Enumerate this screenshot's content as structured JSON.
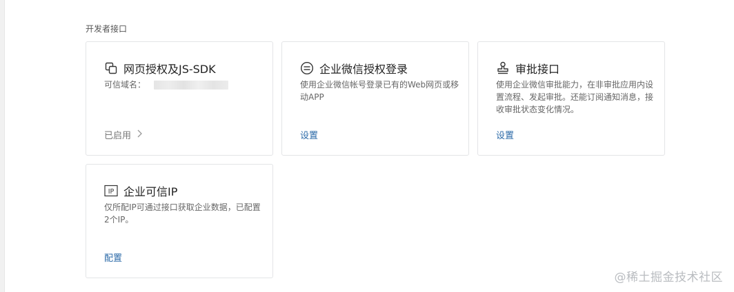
{
  "section": {
    "title": "开发者接口"
  },
  "cards": [
    {
      "title": "网页授权及JS-SDK",
      "icon": "copy-icon",
      "desc_label": "可信域名：",
      "action": "已启用"
    },
    {
      "title": "企业微信授权登录",
      "icon": "minus-circle-icon",
      "desc": "使用企业微信帐号登录已有的Web网页或移动APP",
      "action": "设置"
    },
    {
      "title": "审批接口",
      "icon": "stamp-icon",
      "desc": "使用企业微信审批能力，在非审批应用内设置流程、发起审批。还能订阅通知消息，接收审批状态变化情况。",
      "action": "设置"
    },
    {
      "title": "企业可信IP",
      "icon": "ip-icon",
      "icon_text": "IP",
      "desc": "仅所配IP可通过接口获取企业数据，已配置2个IP。",
      "action": "配置"
    }
  ],
  "watermark": "@稀土掘金技术社区",
  "colors": {
    "link": "#2b6aa8",
    "border": "#e3e4e6"
  }
}
